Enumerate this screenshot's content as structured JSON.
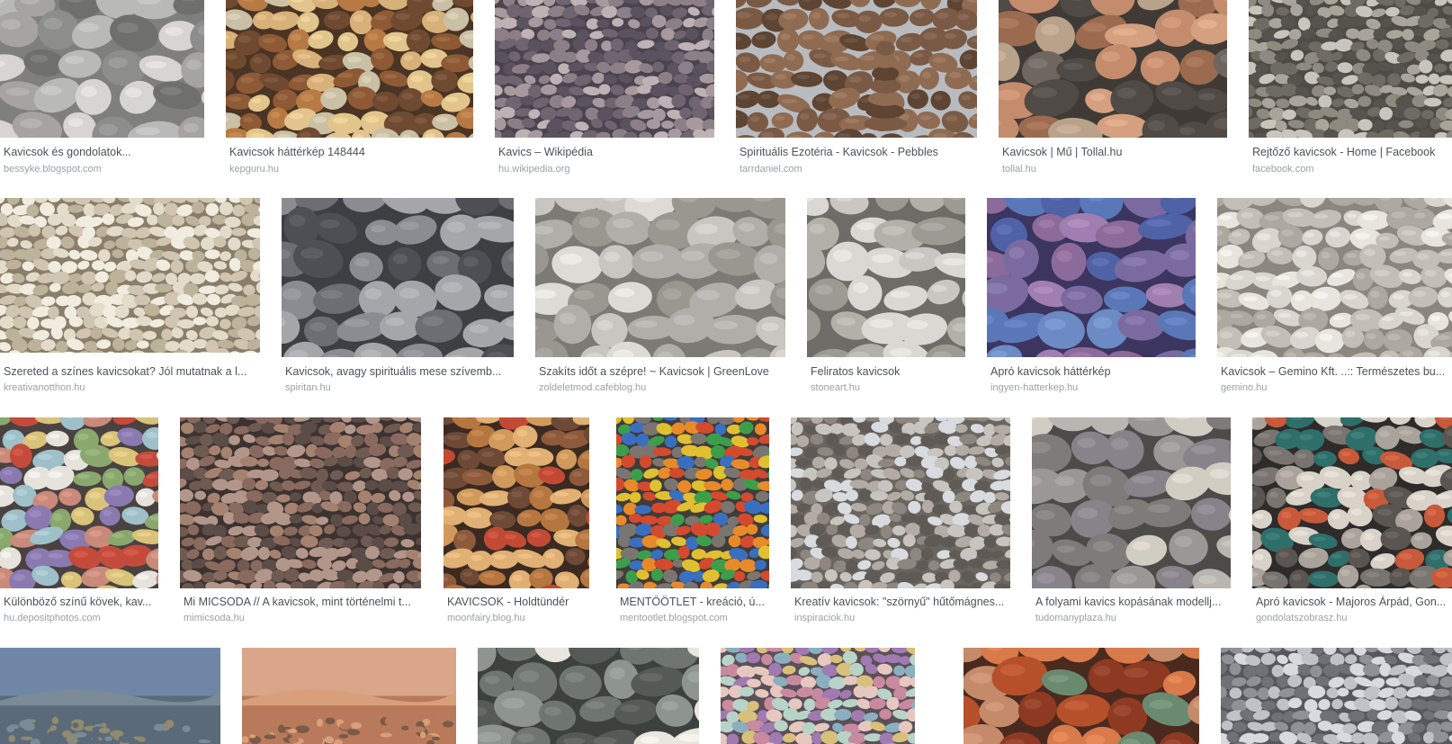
{
  "results": [
    [
      {
        "title": "Kavicsok és gondolatok...",
        "source": "bessyke.blogspot.com",
        "palette": [
          "#b9b9b7",
          "#8d8d8b",
          "#d6d5d2",
          "#6f706e",
          "#a5a4a1"
        ],
        "bg": "#7f7f7d",
        "style": "large"
      },
      {
        "title": "Kavicsok háttérkép 148444",
        "source": "kepguru.hu",
        "palette": [
          "#b77a45",
          "#d8b07a",
          "#8e5a35",
          "#c9c0a6",
          "#6f4a30",
          "#e1c58c"
        ],
        "bg": "#4a3424",
        "style": "medium"
      },
      {
        "title": "Kavics – Wikipédia",
        "source": "hu.wikipedia.org",
        "palette": [
          "#8c7f88",
          "#a8999f",
          "#6f6570",
          "#bfb2b5",
          "#5b5260"
        ],
        "bg": "#4b434e",
        "style": "small"
      },
      {
        "title": "Spirituális Ezotéria - Kavicsok - Pebbles",
        "source": "tarrdaniel.com",
        "palette": [
          "#7a5a45",
          "#5e4433",
          "#8f6b52"
        ],
        "bg": "#b8bcc0",
        "style": "stack"
      },
      {
        "title": "Kavicsok | Mű | Tollal.hu",
        "source": "tollal.hu",
        "palette": [
          "#9c6a4f",
          "#c48c6c",
          "#6f6660",
          "#b9a28a",
          "#4f4a46",
          "#d4a07f"
        ],
        "bg": "#3f3a36",
        "style": "large"
      },
      {
        "title": "Rejtőző kavicsok - Home | Facebook",
        "source": "facebook.com",
        "palette": [
          "#6e6b62",
          "#8e8a80",
          "#c8c5bc",
          "#55534d",
          "#a9a59a"
        ],
        "bg": "#4d4b45",
        "style": "small"
      }
    ],
    [
      {
        "title": "Szereted a színes kavicsokat? Jól mutatnak a l...",
        "source": "kreativanotthon.hu",
        "palette": [
          "#e3dccb",
          "#cfc5b0",
          "#f1ece0",
          "#bdb29a"
        ],
        "bg": "#8a7e6a",
        "style": "small"
      },
      {
        "title": "Kavicsok, avagy spirituális mese szívemb...",
        "source": "spiritan.hu",
        "palette": [
          "#6d6e73",
          "#8b8c91",
          "#4e4f54",
          "#a5a6aa"
        ],
        "bg": "#3e3f43",
        "style": "large"
      },
      {
        "title": "Szakíts időt a szépre! ~ Kavicsok | GreenLove",
        "source": "zoldeletmod.cafeblog.hu",
        "palette": [
          "#c8c6c1",
          "#b0aea8",
          "#dddbd6",
          "#9a9791"
        ],
        "bg": "#7c7a75",
        "style": "large"
      },
      {
        "title": "Feliratos kavicsok",
        "source": "stoneart.hu",
        "palette": [
          "#c9c7c2",
          "#b3b0aa",
          "#dad8d3",
          "#9d9a94"
        ],
        "bg": "#6f6c67",
        "style": "large"
      },
      {
        "title": "Apró kavicsok háttérkép",
        "source": "ingyen-hatterkep.hu",
        "palette": [
          "#7a6aa0",
          "#5a78b8",
          "#8c6a9a",
          "#4f62a6",
          "#a07fb0",
          "#6c8ac4"
        ],
        "bg": "#3b3560",
        "style": "large"
      },
      {
        "title": "Kavicsok – Gemino Kft. ..:: Természetes bu...",
        "source": "gemino.hu",
        "palette": [
          "#d9d6d0",
          "#c3bfb8",
          "#e8e5df",
          "#ada9a1"
        ],
        "bg": "#8b877f",
        "style": "medium"
      }
    ],
    [
      {
        "title": "Különböző színű kövek, kav...",
        "source": "hu.depositphotos.com",
        "palette": [
          "#9fc0c8",
          "#c98a7a",
          "#8aa86e",
          "#d9c27a",
          "#8a7ab0",
          "#e6e3dd",
          "#c44b3c"
        ],
        "bg": "#4a4240",
        "style": "medium"
      },
      {
        "title": "Mi MICSODA // A kavicsok, mint történelmi t...",
        "source": "mimicsoda.hu",
        "palette": [
          "#8a6a5e",
          "#6f5a52",
          "#a58270",
          "#5b4c48",
          "#b3968a"
        ],
        "bg": "#3c3230",
        "style": "small"
      },
      {
        "title": "KAVICSOK - Holdtündér",
        "source": "moonfairy.blog.hu",
        "palette": [
          "#b5763f",
          "#8e5a3c",
          "#d19a5c",
          "#6e4a36",
          "#c24a34",
          "#e0b074"
        ],
        "bg": "#3a2a22",
        "style": "medium"
      },
      {
        "title": "MENTŐÖTLET - kreáció, ú...",
        "source": "mentootlet.blogspot.com",
        "palette": [
          "#d44a2e",
          "#e0c030",
          "#3d9e4a",
          "#3a6fc0",
          "#7a7570",
          "#e88a2a"
        ],
        "bg": "#3f3c3a",
        "style": "small"
      },
      {
        "title": "Kreatív kavicsok: \"szörnyű\" hűtőmágnes...",
        "source": "inspiraciok.hu",
        "palette": [
          "#d8dbe0",
          "#8d8780",
          "#b2aca4",
          "#5f5a55",
          "#c8c4bf"
        ],
        "bg": "#6a655f",
        "style": "small"
      },
      {
        "title": "A folyami kavics kopásának modellj...",
        "source": "tudomanyplaza.hu",
        "palette": [
          "#9a9796",
          "#b9b5b0",
          "#7e7b7a",
          "#d2cdc3",
          "#86838a"
        ],
        "bg": "#4d4b4a",
        "style": "large"
      },
      {
        "title": "Apró kavicsok - Majoros Árpád, Gon...",
        "source": "gondolatszobrasz.hu",
        "palette": [
          "#7a7470",
          "#a9a39c",
          "#c75a3a",
          "#5a5550",
          "#d8d2c8",
          "#2e6f6a"
        ],
        "bg": "#2e2b2a",
        "style": "medium"
      }
    ],
    [
      {
        "title": "",
        "source": "",
        "palette": [
          "#5a6a78",
          "#7a8a96",
          "#8f8a70"
        ],
        "bg": "#6f86a6",
        "style": "landscape"
      },
      {
        "title": "",
        "source": "",
        "palette": [
          "#b87a5a",
          "#d8a07a",
          "#7a5a48"
        ],
        "bg": "#d9a68a",
        "style": "landscape"
      },
      {
        "title": "",
        "source": "",
        "palette": [
          "#6f7670",
          "#8e958f",
          "#555a56",
          "#e8e6de"
        ],
        "bg": "#3d413e",
        "style": "large"
      },
      {
        "title": "",
        "source": "",
        "palette": [
          "#c98aa0",
          "#8ab0c0",
          "#d9c07a",
          "#a07ab0",
          "#b8d4c8",
          "#e6c8c0"
        ],
        "bg": "#5a5058",
        "style": "small"
      },
      {
        "title": "",
        "source": "",
        "palette": [
          "#b5502a",
          "#d87a4a",
          "#8e3a22",
          "#c48a6a",
          "#6a8a70"
        ],
        "bg": "#4a2a1e",
        "style": "large"
      },
      {
        "title": "",
        "source": "",
        "palette": [
          "#bfc2c6",
          "#8e9196",
          "#d8dadd",
          "#6e7176"
        ],
        "bg": "#55585c",
        "style": "small"
      }
    ]
  ]
}
